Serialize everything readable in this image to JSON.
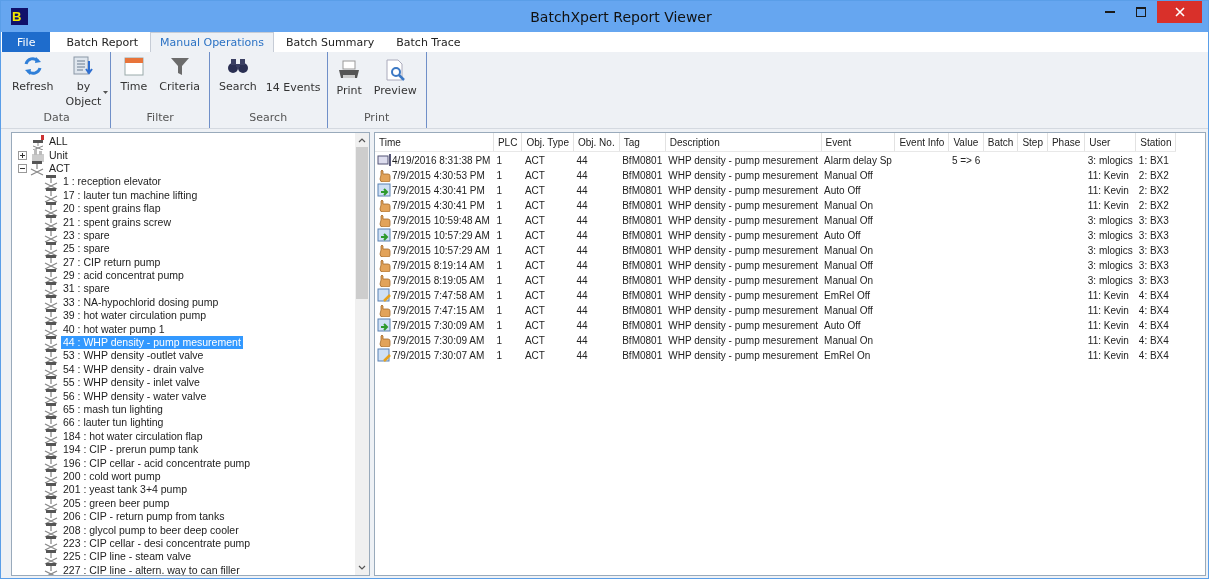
{
  "window": {
    "logo": "B",
    "title": "BatchXpert Report Viewer"
  },
  "tabs": [
    {
      "label": "File",
      "kind": "file",
      "selected": false
    },
    {
      "label": "Batch Report",
      "kind": "tab",
      "selected": false
    },
    {
      "label": "Manual Operations",
      "kind": "tab",
      "selected": true
    },
    {
      "label": "Batch Summary",
      "kind": "tab",
      "selected": false
    },
    {
      "label": "Batch Trace",
      "kind": "tab",
      "selected": false
    }
  ],
  "ribbon": [
    {
      "label": "Data",
      "items": [
        {
          "kind": "refresh",
          "label": "Refresh"
        },
        {
          "kind": "by-object",
          "label": "by\nObject"
        }
      ]
    },
    {
      "label": "Filter",
      "items": [
        {
          "kind": "time",
          "label": "Time"
        },
        {
          "kind": "criteria",
          "label": "Criteria"
        }
      ]
    },
    {
      "label": "Search",
      "items": [
        {
          "kind": "search",
          "label": "Search"
        },
        {
          "kind": "count",
          "label": "14 Events"
        }
      ]
    },
    {
      "label": "Print",
      "items": [
        {
          "kind": "print",
          "label": "Print"
        },
        {
          "kind": "preview",
          "label": "Preview"
        }
      ]
    }
  ],
  "tree": [
    {
      "label": "ALL",
      "kind": "all",
      "selected": false
    },
    {
      "label": "Unit",
      "kind": "unit",
      "expanded": false,
      "selected": false
    },
    {
      "label": "ACT",
      "kind": "actuator",
      "expanded": true,
      "selected": false,
      "children": [
        {
          "label": "1 : reception elevator",
          "selected": false
        },
        {
          "label": "17 : lauter tun machine lifting",
          "selected": false
        },
        {
          "label": "20 : spent grains flap",
          "selected": false
        },
        {
          "label": "21 : spent grains screw",
          "selected": false
        },
        {
          "label": "23 : spare",
          "selected": false
        },
        {
          "label": "25 : spare",
          "selected": false
        },
        {
          "label": "27 : CIP return pump",
          "selected": false
        },
        {
          "label": "29 : acid concentrat pump",
          "selected": false
        },
        {
          "label": "31 : spare",
          "selected": false
        },
        {
          "label": "33 : NA-hypochlorid dosing pump",
          "selected": false
        },
        {
          "label": "39 : hot water circulation pump",
          "selected": false
        },
        {
          "label": "40 : hot water pump 1",
          "selected": false
        },
        {
          "label": "44 : WHP density - pump mesurement",
          "selected": true
        },
        {
          "label": "53 : WHP density -outlet valve",
          "selected": false
        },
        {
          "label": "54 : WHP density - drain valve",
          "selected": false
        },
        {
          "label": "55 : WHP density - inlet valve",
          "selected": false
        },
        {
          "label": "56 : WHP density - water valve",
          "selected": false
        },
        {
          "label": "65 : mash tun lighting",
          "selected": false
        },
        {
          "label": "66 : lauter tun lighting",
          "selected": false
        },
        {
          "label": "184 : hot water circulation flap",
          "selected": false
        },
        {
          "label": "194 : CIP - prerun pump tank",
          "selected": false
        },
        {
          "label": "196 : CIP cellar - acid concentrate pump",
          "selected": false
        },
        {
          "label": "200 : cold wort pump",
          "selected": false
        },
        {
          "label": "201 : yeast tank 3+4 pump",
          "selected": false
        },
        {
          "label": "205 : green beer pump",
          "selected": false
        },
        {
          "label": "206 : CIP - return pump from tanks",
          "selected": false
        },
        {
          "label": "208 : glycol pump to beer deep cooler",
          "selected": false
        },
        {
          "label": "223 : CIP cellar - desi concentrate pump",
          "selected": false
        },
        {
          "label": "225 : CIP line - steam valve",
          "selected": false
        },
        {
          "label": "227 : CIP line - altern. way to can filler",
          "selected": false
        }
      ]
    }
  ],
  "table": {
    "columns": [
      "Time",
      "PLC",
      "Obj. Type",
      "Obj. No.",
      "Tag",
      "Description",
      "Event",
      "Event Info",
      "Value",
      "Batch",
      "Step",
      "Phase",
      "User",
      "Station"
    ],
    "rows": [
      {
        "kind": "setpoint",
        "cells": [
          "4/19/2016 8:31:38 PM",
          "1",
          "ACT",
          "44",
          "BfM0801",
          "WHP density - pump mesurement",
          "Alarm delay Sp",
          "",
          "5 => 6",
          "",
          "",
          "",
          "3: mlogics",
          "1: BX1"
        ]
      },
      {
        "kind": "manual",
        "cells": [
          "7/9/2015 4:30:53 PM",
          "1",
          "ACT",
          "44",
          "BfM0801",
          "WHP density - pump mesurement",
          "Manual Off",
          "",
          "",
          "",
          "",
          "",
          "11: Kevin",
          "2: BX2"
        ]
      },
      {
        "kind": "auto",
        "cells": [
          "7/9/2015 4:30:41 PM",
          "1",
          "ACT",
          "44",
          "BfM0801",
          "WHP density - pump mesurement",
          "Auto Off",
          "",
          "",
          "",
          "",
          "",
          "11: Kevin",
          "2: BX2"
        ]
      },
      {
        "kind": "manual",
        "cells": [
          "7/9/2015 4:30:41 PM",
          "1",
          "ACT",
          "44",
          "BfM0801",
          "WHP density - pump mesurement",
          "Manual On",
          "",
          "",
          "",
          "",
          "",
          "11: Kevin",
          "2: BX2"
        ]
      },
      {
        "kind": "manual",
        "cells": [
          "7/9/2015 10:59:48 AM",
          "1",
          "ACT",
          "44",
          "BfM0801",
          "WHP density - pump mesurement",
          "Manual Off",
          "",
          "",
          "",
          "",
          "",
          "3: mlogics",
          "3: BX3"
        ]
      },
      {
        "kind": "auto",
        "cells": [
          "7/9/2015 10:57:29 AM",
          "1",
          "ACT",
          "44",
          "BfM0801",
          "WHP density - pump mesurement",
          "Auto Off",
          "",
          "",
          "",
          "",
          "",
          "3: mlogics",
          "3: BX3"
        ]
      },
      {
        "kind": "manual",
        "cells": [
          "7/9/2015 10:57:29 AM",
          "1",
          "ACT",
          "44",
          "BfM0801",
          "WHP density - pump mesurement",
          "Manual On",
          "",
          "",
          "",
          "",
          "",
          "3: mlogics",
          "3: BX3"
        ]
      },
      {
        "kind": "manual",
        "cells": [
          "7/9/2015 8:19:14 AM",
          "1",
          "ACT",
          "44",
          "BfM0801",
          "WHP density - pump mesurement",
          "Manual Off",
          "",
          "",
          "",
          "",
          "",
          "3: mlogics",
          "3: BX3"
        ]
      },
      {
        "kind": "manual",
        "cells": [
          "7/9/2015 8:19:05 AM",
          "1",
          "ACT",
          "44",
          "BfM0801",
          "WHP density - pump mesurement",
          "Manual On",
          "",
          "",
          "",
          "",
          "",
          "3: mlogics",
          "3: BX3"
        ]
      },
      {
        "kind": "emrel",
        "cells": [
          "7/9/2015 7:47:58 AM",
          "1",
          "ACT",
          "44",
          "BfM0801",
          "WHP density - pump mesurement",
          "EmRel Off",
          "",
          "",
          "",
          "",
          "",
          "11: Kevin",
          "4: BX4"
        ]
      },
      {
        "kind": "manual",
        "cells": [
          "7/9/2015 7:47:15 AM",
          "1",
          "ACT",
          "44",
          "BfM0801",
          "WHP density - pump mesurement",
          "Manual Off",
          "",
          "",
          "",
          "",
          "",
          "11: Kevin",
          "4: BX4"
        ]
      },
      {
        "kind": "auto",
        "cells": [
          "7/9/2015 7:30:09 AM",
          "1",
          "ACT",
          "44",
          "BfM0801",
          "WHP density - pump mesurement",
          "Auto Off",
          "",
          "",
          "",
          "",
          "",
          "11: Kevin",
          "4: BX4"
        ]
      },
      {
        "kind": "manual",
        "cells": [
          "7/9/2015 7:30:09 AM",
          "1",
          "ACT",
          "44",
          "BfM0801",
          "WHP density - pump mesurement",
          "Manual On",
          "",
          "",
          "",
          "",
          "",
          "11: Kevin",
          "4: BX4"
        ]
      },
      {
        "kind": "emrel",
        "cells": [
          "7/9/2015 7:30:07 AM",
          "1",
          "ACT",
          "44",
          "BfM0801",
          "WHP density - pump mesurement",
          "EmRel On",
          "",
          "",
          "",
          "",
          "",
          "11: Kevin",
          "4: BX4"
        ]
      }
    ]
  }
}
